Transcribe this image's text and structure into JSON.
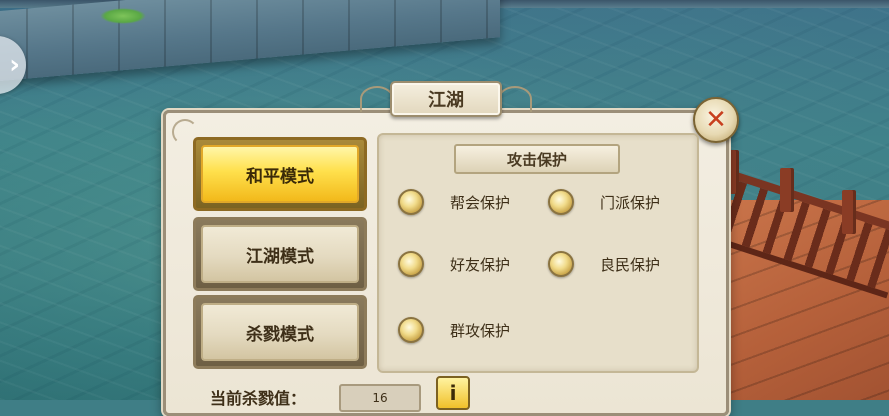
{
  "dialog": {
    "title": "江湖",
    "close_icon": "close-x-icon"
  },
  "modes": [
    {
      "label": "和平模式",
      "active": true
    },
    {
      "label": "江湖模式",
      "active": false
    },
    {
      "label": "杀戮模式",
      "active": false
    }
  ],
  "protection": {
    "title": "攻击保护",
    "options": [
      {
        "label": "帮会保护"
      },
      {
        "label": "门派保护"
      },
      {
        "label": "好友保护"
      },
      {
        "label": "良民保护"
      },
      {
        "label": "群攻保护"
      }
    ]
  },
  "kill_value": {
    "label": "当前杀戮值：",
    "value": "16"
  },
  "info_button": {
    "label": "i",
    "icon": "info-icon"
  },
  "nav": {
    "icon": "chevron-right-icon",
    "glyph": "›"
  }
}
